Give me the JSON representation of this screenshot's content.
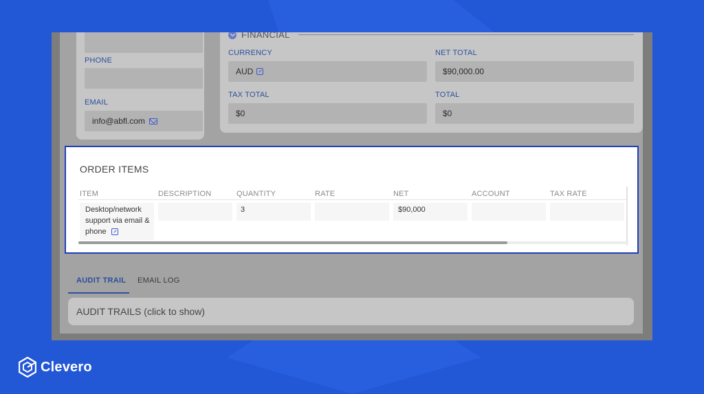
{
  "contact": {
    "phone_label": "PHONE",
    "phone_value": "",
    "email_label": "EMAIL",
    "email_value": "info@abfl.com"
  },
  "financial": {
    "section_title": "FINANCIAL",
    "currency_label": "CURRENCY",
    "currency_value": "AUD",
    "net_total_label": "NET TOTAL",
    "net_total_value": "$90,000.00",
    "tax_total_label": "TAX TOTAL",
    "tax_total_value": "$0",
    "total_label": "TOTAL",
    "total_value": "$0"
  },
  "order_items": {
    "title": "ORDER ITEMS",
    "columns": [
      "ITEM",
      "DESCRIPTION",
      "QUANTITY",
      "RATE",
      "NET",
      "ACCOUNT",
      "TAX RATE"
    ],
    "rows": [
      {
        "item_line1": "Desktop/network",
        "item_line2": "support via email &",
        "item_line3": "phone",
        "description": "",
        "quantity": "3",
        "rate": "",
        "net": "$90,000",
        "account": "",
        "tax_rate": ""
      }
    ],
    "scroll_fraction": 0.78
  },
  "tabs": [
    {
      "label": "AUDIT TRAIL",
      "active": true
    },
    {
      "label": "EMAIL LOG",
      "active": false
    }
  ],
  "audit": {
    "label": "AUDIT TRAILS (click to show)"
  },
  "brand": {
    "name": "Clevero"
  },
  "colors": {
    "background": "#2257d6",
    "accent": "#1f3fb8",
    "label_blue": "#2a4f9c"
  },
  "icons": {
    "currency_link": "external-link-icon",
    "email_link": "mail-icon",
    "item_link": "external-link-icon",
    "section_toggle": "chevron-down-icon",
    "brand": "clevero-logo-icon"
  }
}
